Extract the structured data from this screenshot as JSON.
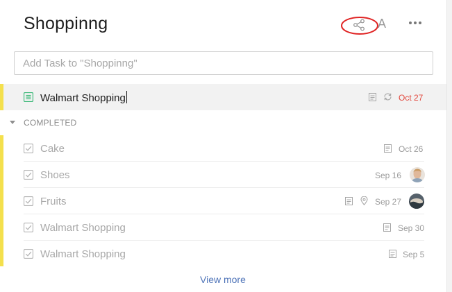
{
  "header": {
    "title": "Shoppinng",
    "share_icon": "share-icon",
    "sort_label": "A",
    "more_icon": "more-dots-icon",
    "annotation_color": "#e02424"
  },
  "add_task": {
    "placeholder": "Add Task to \"Shoppinng\"",
    "value": ""
  },
  "active_task": {
    "title": "Walmart Shopping",
    "icons": [
      "note-icon",
      "repeat-icon"
    ],
    "due": "Oct 27",
    "due_color": "#e2493f",
    "priority_color": "#f4e04d"
  },
  "completed": {
    "label": "COMPLETED",
    "items": [
      {
        "title": "Cake",
        "due": "Oct 26",
        "icons": [
          "note-icon"
        ]
      },
      {
        "title": "Shoes",
        "due": "Sep 16",
        "icons": [
          "avatar"
        ]
      },
      {
        "title": "Fruits",
        "due": "Sep 27",
        "icons": [
          "note-icon",
          "location-icon",
          "avatar"
        ]
      },
      {
        "title": "Walmart Shopping",
        "due": "Sep 30",
        "icons": [
          "note-icon"
        ]
      },
      {
        "title": "Walmart Shopping",
        "due": "Sep 5",
        "icons": [
          "note-icon"
        ]
      }
    ]
  },
  "view_more": "View more"
}
